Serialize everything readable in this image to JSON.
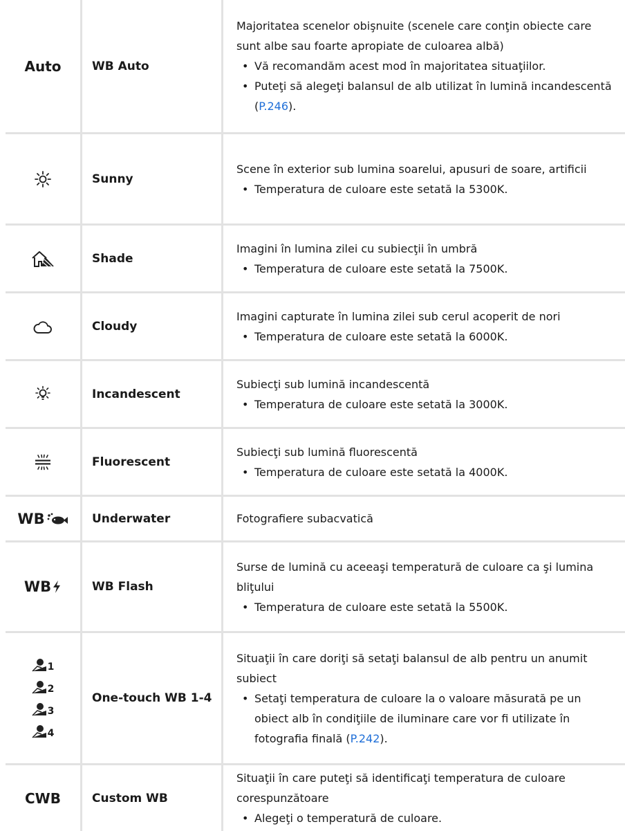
{
  "rows": [
    {
      "icon": "Auto",
      "name": "WB Auto",
      "desc": "Majoritatea scenelor obişnuite (scenele care conţin obiecte care sunt albe sau foarte apropiate de culoarea albă)",
      "b1": "Vă recomandăm acest mod în majoritatea situaţiilor.",
      "b2_pre": "Puteţi să alegeţi balansul de alb utilizat în lumină incandescentă (",
      "b2_link": "P.246",
      "b2_post": ")."
    },
    {
      "icon": "sun-icon",
      "name": "Sunny",
      "desc": "Scene în exterior sub lumina soarelui, apusuri de soare, artificii",
      "b1": "Temperatura de culoare este setată la 5300K."
    },
    {
      "icon": "shade-icon",
      "name": "Shade",
      "desc": "Imagini în lumina zilei cu subiecţii în umbră",
      "b1": "Temperatura de culoare este setată la 7500K."
    },
    {
      "icon": "cloud-icon",
      "name": "Cloudy",
      "desc": "Imagini capturate în lumina zilei sub cerul acoperit de nori",
      "b1": "Temperatura de culoare este setată la 6000K."
    },
    {
      "icon": "bulb-icon",
      "name": "Incandescent",
      "desc": "Subiecţi sub lumină incandescentă",
      "b1": "Temperatura de culoare este setată la 3000K."
    },
    {
      "icon": "fluorescent-icon",
      "name": "Fluorescent",
      "desc": "Subiecţi sub lumină fluorescentă",
      "b1": "Temperatura de culoare este setată la 4000K."
    },
    {
      "icon": "WB",
      "name": "Underwater",
      "desc": "Fotografiere subacvatică"
    },
    {
      "icon": "WB",
      "name": "WB Flash",
      "desc": "Surse de lumină cu aceeaşi temperatură de culoare ca şi lumina bliţului",
      "b1": "Temperatura de culoare este setată la 5500K."
    },
    {
      "icons": [
        "1",
        "2",
        "3",
        "4"
      ],
      "name": "One-touch WB 1-4",
      "desc": "Situaţii în care doriţi să setaţi balansul de alb pentru un anumit subiect",
      "b1_pre": "Setaţi temperatura de culoare la o valoare măsurată pe un obiect alb în condiţiile de iluminare care vor fi utilizate în fotografia finală (",
      "b1_link": "P.242",
      "b1_post": ")."
    },
    {
      "icon": "CWB",
      "name": "Custom WB",
      "desc": "Situaţii în care puteţi să identificaţi temperatura de culoare corespunzătoare",
      "b1": "Alegeţi o temperatură de culoare."
    }
  ]
}
